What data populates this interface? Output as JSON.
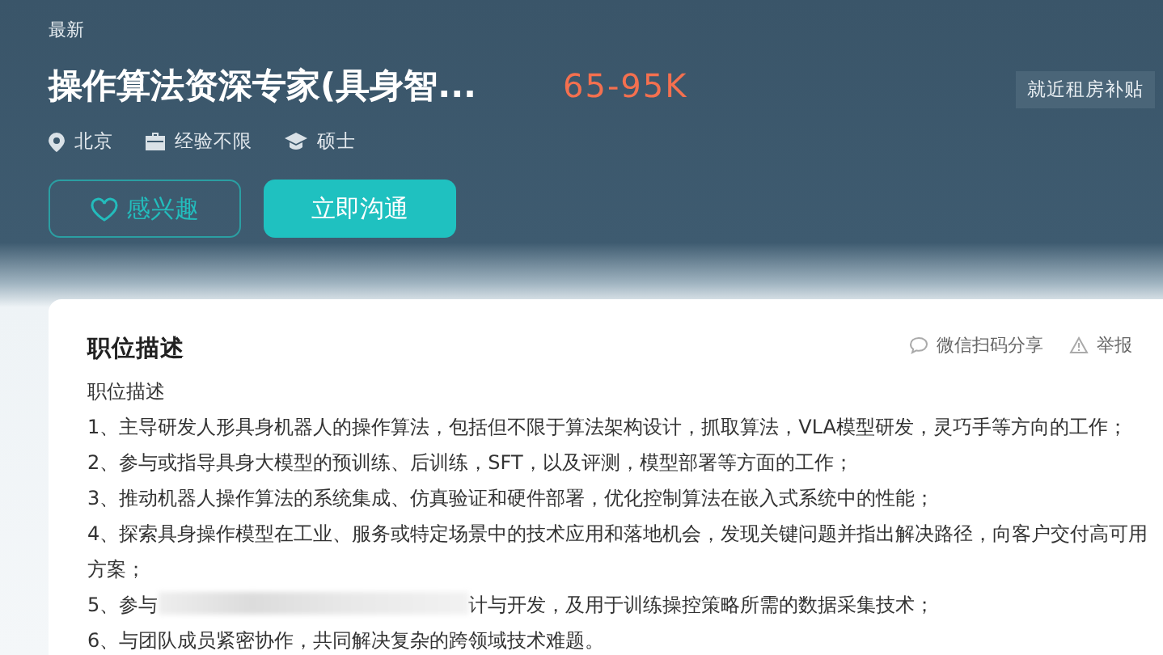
{
  "header": {
    "badge": "最新",
    "title": "操作算法资深专家(具身智...",
    "salary": "65-95K",
    "tags": [
      "就近租房补贴"
    ],
    "meta": [
      {
        "kind": "location",
        "text": "北京"
      },
      {
        "kind": "experience",
        "text": "经验不限"
      },
      {
        "kind": "degree",
        "text": "硕士"
      }
    ],
    "buttons": [
      {
        "kind": "interest",
        "label": "感兴趣"
      },
      {
        "kind": "chat",
        "label": "立即沟通"
      }
    ]
  },
  "description": {
    "title": "职位描述",
    "actions": [
      {
        "kind": "share",
        "label": "微信扫码分享"
      },
      {
        "kind": "report",
        "label": "举报"
      }
    ],
    "lines": [
      {
        "kind": "text",
        "text": "职位描述"
      },
      {
        "kind": "text",
        "text": "1、主导研发人形具身机器人的操作算法，包括但不限于算法架构设计，抓取算法，VLA模型研发，灵巧手等方向的工作；"
      },
      {
        "kind": "text",
        "text": "2、参与或指导具身大模型的预训练、后训练，SFT，以及评测，模型部署等方面的工作；"
      },
      {
        "kind": "text",
        "text": "3、推动机器人操作算法的系统集成、仿真验证和硬件部署，优化控制算法在嵌入式系统中的性能；"
      },
      {
        "kind": "text",
        "text": "4、探索具身操作模型在工业、服务或特定场景中的技术应用和落地机会，发现关键问题并指出解决路径，向客户交付高可用方案；"
      },
      {
        "kind": "blurred",
        "before": "5、参与",
        "after": "计与开发，及用于训练操控策略所需的数据采集技术；"
      },
      {
        "kind": "text",
        "text": "6、与团队成员紧密协作，共同解决复杂的跨领域技术难题。"
      }
    ]
  }
}
